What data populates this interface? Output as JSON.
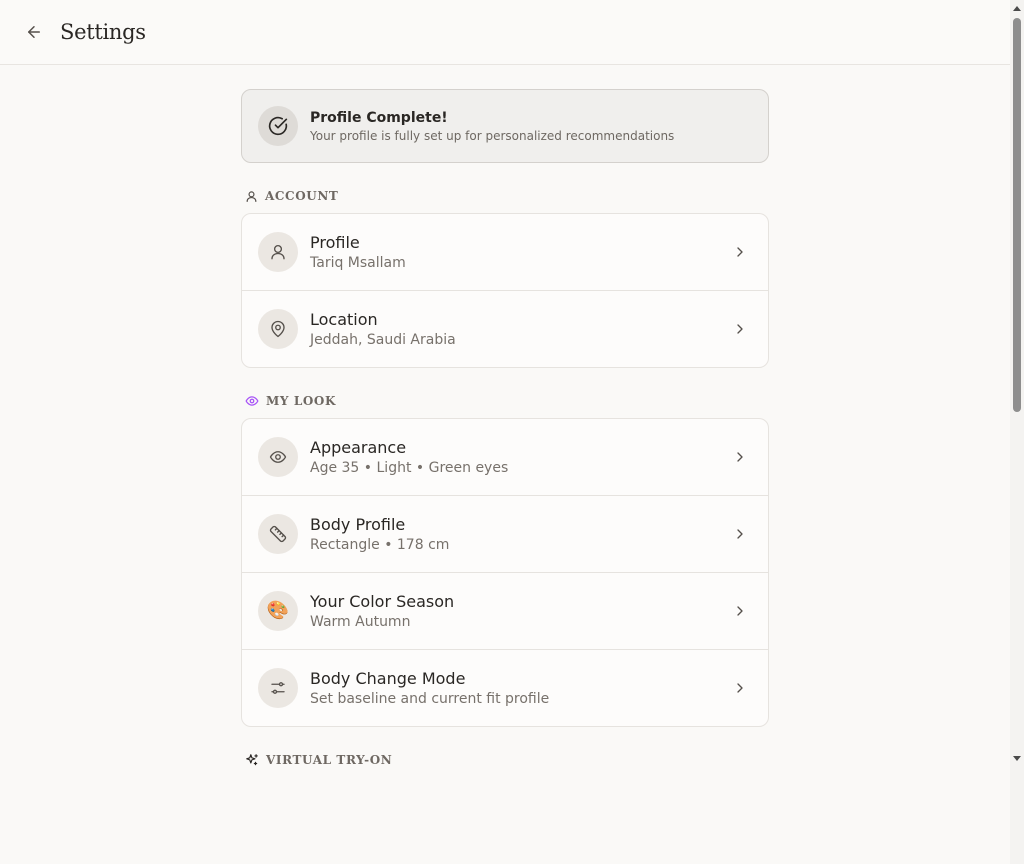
{
  "header": {
    "title": "Settings",
    "back_icon": "arrow-left-icon"
  },
  "banner": {
    "title": "Profile Complete!",
    "subtitle": "Your profile is fully set up for personalized recommendations",
    "icon": "check-circle-icon"
  },
  "sections": {
    "account": {
      "label": "ACCOUNT",
      "icon": "user-icon",
      "items": [
        {
          "title": "Profile",
          "subtitle": "Tariq Msallam",
          "icon": "user-icon"
        },
        {
          "title": "Location",
          "subtitle": "Jeddah, Saudi Arabia",
          "icon": "map-pin-icon"
        }
      ]
    },
    "my_look": {
      "label": "MY LOOK",
      "icon": "eye-icon",
      "icon_color": "#a855f7",
      "items": [
        {
          "title": "Appearance",
          "subtitle": "Age 35 • Light • Green eyes",
          "icon": "eye-icon"
        },
        {
          "title": "Body Profile",
          "subtitle": "Rectangle • 178 cm",
          "icon": "ruler-icon"
        },
        {
          "title": "Your Color Season",
          "subtitle": "Warm Autumn",
          "icon": "palette-emoji-icon",
          "emoji": "🎨"
        },
        {
          "title": "Body Change Mode",
          "subtitle": "Set baseline and current fit profile",
          "icon": "sliders-icon"
        }
      ]
    },
    "virtual_try_on": {
      "label": "VIRTUAL TRY-ON",
      "icon": "sparkles-icon"
    }
  },
  "colors": {
    "background": "#faf9f7",
    "card": "#fdfcfb",
    "border": "#e6e3df",
    "text": "#2a2724",
    "muted": "#77716b",
    "accent_purple": "#a855f7"
  }
}
